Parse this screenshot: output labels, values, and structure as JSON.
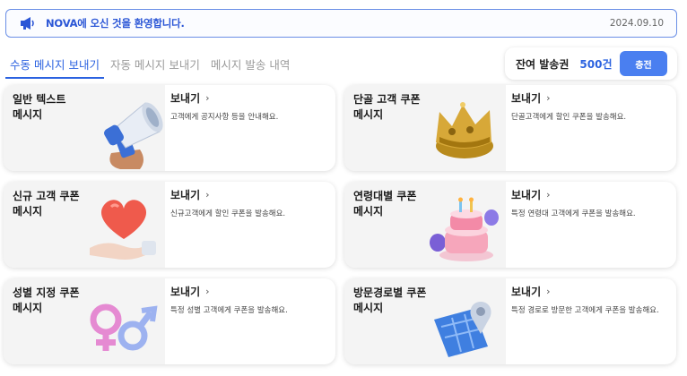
{
  "notice": {
    "message": "NOVA에 오신 것을 환영합니다.",
    "date": "2024.09.10",
    "icon": "megaphone-icon"
  },
  "tabs": [
    {
      "label": "수동 메시지 보내기",
      "active": true
    },
    {
      "label": "자동 메시지 보내기",
      "active": false
    },
    {
      "label": "메시지 발송 내역",
      "active": false
    }
  ],
  "balance": {
    "label": "잔여 발송권",
    "amount": "500건",
    "charge_label": "충전"
  },
  "colors": {
    "accent": "#2b62e0",
    "button": "#4a7ff0"
  },
  "cards": [
    {
      "title": "일반 텍스트\n메시지",
      "send_label": "보내기",
      "description": "고객에게 공지사항 등을 안내해요.",
      "icon": "megaphone-illustration"
    },
    {
      "title": "단골 고객 쿠폰\n메시지",
      "send_label": "보내기",
      "description": "단골고객에게 할인 쿠폰을 발송해요.",
      "icon": "crown-illustration"
    },
    {
      "title": "신규 고객 쿠폰\n메시지",
      "send_label": "보내기",
      "description": "신규고객에게 할인 쿠폰을 발송해요.",
      "icon": "heart-hand-illustration"
    },
    {
      "title": "연령대별 쿠폰\n메시지",
      "send_label": "보내기",
      "description": "특정 연령대 고객에게 쿠폰을 발송해요.",
      "icon": "birthday-cake-illustration"
    },
    {
      "title": "성별 지정 쿠폰\n메시지",
      "send_label": "보내기",
      "description": "특정 성별 고객에게 쿠폰을 발송해요.",
      "icon": "gender-symbols-illustration"
    },
    {
      "title": "방문경로별 쿠폰\n메시지",
      "send_label": "보내기",
      "description": "특정 경로로 방문한 고객에게 쿠폰을 발송해요.",
      "icon": "map-pin-illustration"
    }
  ]
}
